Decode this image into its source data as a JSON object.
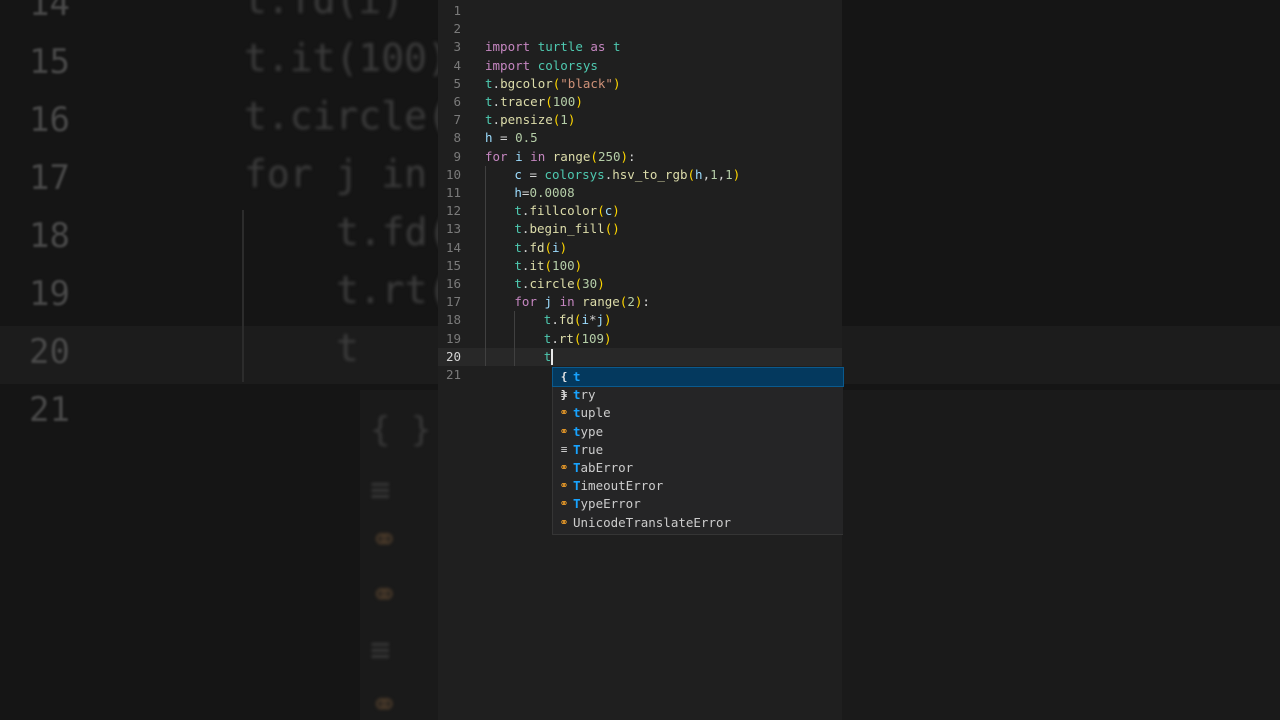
{
  "background": {
    "lines": [
      {
        "num": "14",
        "code": "t.fd(i)"
      },
      {
        "num": "15",
        "code": "t.it(100)"
      },
      {
        "num": "16",
        "code": "t.circle("
      },
      {
        "num": "17",
        "code": "for j in"
      },
      {
        "num": "18",
        "code": "t.fd("
      },
      {
        "num": "19",
        "code": "t.rt("
      },
      {
        "num": "20",
        "code": "t"
      },
      {
        "num": "21",
        "code": ""
      }
    ]
  },
  "editor": {
    "line_numbers": [
      "1",
      "2",
      "3",
      "4",
      "5",
      "6",
      "7",
      "8",
      "9",
      "10",
      "11",
      "12",
      "13",
      "14",
      "15",
      "16",
      "17",
      "18",
      "19",
      "20",
      "21"
    ],
    "current_line": "20",
    "lines": [
      {
        "tokens": []
      },
      {
        "tokens": []
      },
      {
        "tokens": [
          {
            "t": "import",
            "c": "kw"
          },
          {
            "t": " ",
            "c": "op"
          },
          {
            "t": "turtle",
            "c": "mod"
          },
          {
            "t": " ",
            "c": "op"
          },
          {
            "t": "as",
            "c": "kw"
          },
          {
            "t": " ",
            "c": "op"
          },
          {
            "t": "t",
            "c": "mod"
          }
        ]
      },
      {
        "tokens": [
          {
            "t": "import",
            "c": "kw"
          },
          {
            "t": " ",
            "c": "op"
          },
          {
            "t": "colorsys",
            "c": "mod"
          }
        ]
      },
      {
        "tokens": [
          {
            "t": "t",
            "c": "mod"
          },
          {
            "t": ".",
            "c": "op"
          },
          {
            "t": "bgcolor",
            "c": "fn"
          },
          {
            "t": "(",
            "c": "br1"
          },
          {
            "t": "\"black\"",
            "c": "str"
          },
          {
            "t": ")",
            "c": "br1"
          }
        ]
      },
      {
        "tokens": [
          {
            "t": "t",
            "c": "mod"
          },
          {
            "t": ".",
            "c": "op"
          },
          {
            "t": "tracer",
            "c": "fn"
          },
          {
            "t": "(",
            "c": "br1"
          },
          {
            "t": "100",
            "c": "num"
          },
          {
            "t": ")",
            "c": "br1"
          }
        ]
      },
      {
        "tokens": [
          {
            "t": "t",
            "c": "mod"
          },
          {
            "t": ".",
            "c": "op"
          },
          {
            "t": "pensize",
            "c": "fn"
          },
          {
            "t": "(",
            "c": "br1"
          },
          {
            "t": "1",
            "c": "num"
          },
          {
            "t": ")",
            "c": "br1"
          }
        ]
      },
      {
        "tokens": [
          {
            "t": "h",
            "c": "id"
          },
          {
            "t": " = ",
            "c": "op"
          },
          {
            "t": "0.5",
            "c": "num"
          }
        ]
      },
      {
        "tokens": [
          {
            "t": "for",
            "c": "kw"
          },
          {
            "t": " ",
            "c": "op"
          },
          {
            "t": "i",
            "c": "id"
          },
          {
            "t": " ",
            "c": "op"
          },
          {
            "t": "in",
            "c": "kw"
          },
          {
            "t": " ",
            "c": "op"
          },
          {
            "t": "range",
            "c": "fn"
          },
          {
            "t": "(",
            "c": "br1"
          },
          {
            "t": "250",
            "c": "num"
          },
          {
            "t": ")",
            "c": "br1"
          },
          {
            "t": ":",
            "c": "op"
          }
        ]
      },
      {
        "indent": 1,
        "tokens": [
          {
            "t": "c",
            "c": "id"
          },
          {
            "t": " = ",
            "c": "op"
          },
          {
            "t": "colorsys",
            "c": "mod"
          },
          {
            "t": ".",
            "c": "op"
          },
          {
            "t": "hsv_to_rgb",
            "c": "fn"
          },
          {
            "t": "(",
            "c": "br1"
          },
          {
            "t": "h",
            "c": "id"
          },
          {
            "t": ",",
            "c": "op"
          },
          {
            "t": "1",
            "c": "num"
          },
          {
            "t": ",",
            "c": "op"
          },
          {
            "t": "1",
            "c": "num"
          },
          {
            "t": ")",
            "c": "br1"
          }
        ]
      },
      {
        "indent": 1,
        "tokens": [
          {
            "t": "h",
            "c": "id"
          },
          {
            "t": "=",
            "c": "op"
          },
          {
            "t": "0.0008",
            "c": "num"
          }
        ]
      },
      {
        "indent": 1,
        "tokens": [
          {
            "t": "t",
            "c": "mod"
          },
          {
            "t": ".",
            "c": "op"
          },
          {
            "t": "fillcolor",
            "c": "fn"
          },
          {
            "t": "(",
            "c": "br1"
          },
          {
            "t": "c",
            "c": "id"
          },
          {
            "t": ")",
            "c": "br1"
          }
        ]
      },
      {
        "indent": 1,
        "tokens": [
          {
            "t": "t",
            "c": "mod"
          },
          {
            "t": ".",
            "c": "op"
          },
          {
            "t": "begin_fill",
            "c": "fn"
          },
          {
            "t": "(",
            "c": "br1"
          },
          {
            "t": ")",
            "c": "br1"
          }
        ]
      },
      {
        "indent": 1,
        "tokens": [
          {
            "t": "t",
            "c": "mod"
          },
          {
            "t": ".",
            "c": "op"
          },
          {
            "t": "fd",
            "c": "fn"
          },
          {
            "t": "(",
            "c": "br1"
          },
          {
            "t": "i",
            "c": "id"
          },
          {
            "t": ")",
            "c": "br1"
          }
        ]
      },
      {
        "indent": 1,
        "tokens": [
          {
            "t": "t",
            "c": "mod"
          },
          {
            "t": ".",
            "c": "op"
          },
          {
            "t": "it",
            "c": "fn"
          },
          {
            "t": "(",
            "c": "br1"
          },
          {
            "t": "100",
            "c": "num"
          },
          {
            "t": ")",
            "c": "br1"
          }
        ]
      },
      {
        "indent": 1,
        "tokens": [
          {
            "t": "t",
            "c": "mod"
          },
          {
            "t": ".",
            "c": "op"
          },
          {
            "t": "circle",
            "c": "fn"
          },
          {
            "t": "(",
            "c": "br1"
          },
          {
            "t": "30",
            "c": "num"
          },
          {
            "t": ")",
            "c": "br1"
          }
        ]
      },
      {
        "indent": 1,
        "tokens": [
          {
            "t": "for",
            "c": "kw"
          },
          {
            "t": " ",
            "c": "op"
          },
          {
            "t": "j",
            "c": "id"
          },
          {
            "t": " ",
            "c": "op"
          },
          {
            "t": "in",
            "c": "kw"
          },
          {
            "t": " ",
            "c": "op"
          },
          {
            "t": "range",
            "c": "fn"
          },
          {
            "t": "(",
            "c": "br1"
          },
          {
            "t": "2",
            "c": "num"
          },
          {
            "t": ")",
            "c": "br1"
          },
          {
            "t": ":",
            "c": "op"
          }
        ]
      },
      {
        "indent": 2,
        "tokens": [
          {
            "t": "t",
            "c": "mod"
          },
          {
            "t": ".",
            "c": "op"
          },
          {
            "t": "fd",
            "c": "fn"
          },
          {
            "t": "(",
            "c": "br1"
          },
          {
            "t": "i",
            "c": "id"
          },
          {
            "t": "*",
            "c": "op"
          },
          {
            "t": "j",
            "c": "id"
          },
          {
            "t": ")",
            "c": "br1"
          }
        ]
      },
      {
        "indent": 2,
        "tokens": [
          {
            "t": "t",
            "c": "mod"
          },
          {
            "t": ".",
            "c": "op"
          },
          {
            "t": "rt",
            "c": "fn"
          },
          {
            "t": "(",
            "c": "br1"
          },
          {
            "t": "109",
            "c": "num"
          },
          {
            "t": ")",
            "c": "br1"
          }
        ]
      },
      {
        "indent": 2,
        "tokens": [
          {
            "t": "t",
            "c": "mod"
          }
        ]
      },
      {
        "tokens": []
      }
    ]
  },
  "suggest": {
    "typed_prefix": "t",
    "items": [
      {
        "label": "t",
        "icon": "variable-icon",
        "kind": "var"
      },
      {
        "label": "try",
        "icon": "keyword-icon",
        "kind": "kw"
      },
      {
        "label": "tuple",
        "icon": "class-icon",
        "kind": "cls"
      },
      {
        "label": "type",
        "icon": "class-icon",
        "kind": "cls"
      },
      {
        "label": "True",
        "icon": "keyword-icon",
        "kind": "kw"
      },
      {
        "label": "TabError",
        "icon": "class-icon",
        "kind": "cls"
      },
      {
        "label": "TimeoutError",
        "icon": "class-icon",
        "kind": "cls"
      },
      {
        "label": "TypeError",
        "icon": "class-icon",
        "kind": "cls"
      },
      {
        "label": "UnicodeTranslateError",
        "icon": "class-icon",
        "kind": "cls"
      }
    ]
  },
  "colors": {
    "editor_bg": "#1f1f1f",
    "keyword": "#c586c0",
    "function": "#dcdcaa",
    "module": "#4ec9b0",
    "number": "#b5cea8",
    "string": "#ce9178",
    "match_highlight": "#18a3ff",
    "class_icon": "#ee9d28"
  }
}
